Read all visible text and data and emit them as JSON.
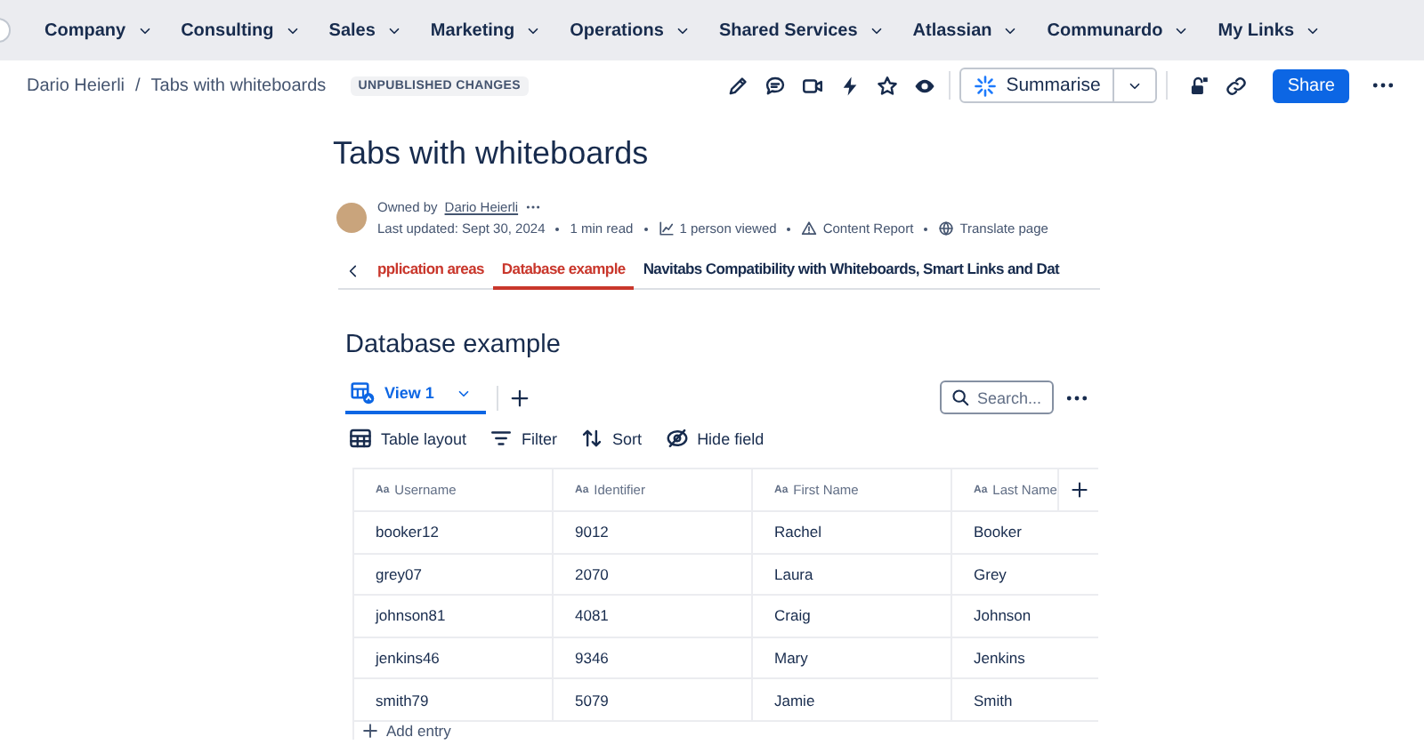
{
  "top_nav": {
    "items": [
      "Company",
      "Consulting",
      "Sales",
      "Marketing",
      "Operations",
      "Shared Services",
      "Atlassian",
      "Communardo",
      "My Links"
    ]
  },
  "header": {
    "breadcrumbs": [
      "Dario Heierli",
      "Tabs with whiteboards"
    ],
    "separator": "/",
    "badge": "UNPUBLISHED CHANGES",
    "summarise_button": "Summarise",
    "share_button": "Share"
  },
  "page": {
    "title": "Tabs with whiteboards",
    "owned_by_label": "Owned by",
    "owner": "Dario Heierli",
    "meta": [
      {
        "kind": "text",
        "label": "Last updated: Sept 30, 2024"
      },
      {
        "kind": "text",
        "label": "1 min read"
      },
      {
        "kind": "views",
        "label": "1 person viewed"
      },
      {
        "kind": "report",
        "label": "Content Report"
      },
      {
        "kind": "translate",
        "label": "Translate page"
      }
    ]
  },
  "tabs": [
    {
      "label": "pplication areas",
      "selected": false,
      "hovered": true
    },
    {
      "label": "Database example",
      "selected": true,
      "hovered": false
    },
    {
      "label": "Navitabs Compatibility with Whiteboards, Smart Links and Dat",
      "selected": false,
      "hovered": false
    }
  ],
  "database": {
    "title": "Database example",
    "views": [
      {
        "label": "View 1",
        "selected": true
      }
    ],
    "search": {
      "placeholder": "Search..."
    },
    "toolbar": [
      {
        "kind": "layout",
        "label": "Table layout"
      },
      {
        "kind": "filter",
        "label": "Filter"
      },
      {
        "kind": "sort",
        "label": "Sort"
      },
      {
        "kind": "hide",
        "label": "Hide field"
      }
    ],
    "table": {
      "columns": [
        {
          "type_icon": "Aa",
          "label": "Username"
        },
        {
          "type_icon": "Aa",
          "label": "Identifier"
        },
        {
          "type_icon": "Aa",
          "label": "First Name"
        },
        {
          "type_icon": "Aa",
          "label": "Last Name"
        }
      ],
      "rows": [
        [
          "booker12",
          "9012",
          "Rachel",
          "Booker"
        ],
        [
          "grey07",
          "2070",
          "Laura",
          "Grey"
        ],
        [
          "johnson81",
          "4081",
          "Craig",
          "Johnson"
        ],
        [
          "jenkins46",
          "9346",
          "Mary",
          "Jenkins"
        ],
        [
          "smith79",
          "5079",
          "Jamie",
          "Smith"
        ]
      ]
    },
    "add_entry": "Add entry"
  }
}
